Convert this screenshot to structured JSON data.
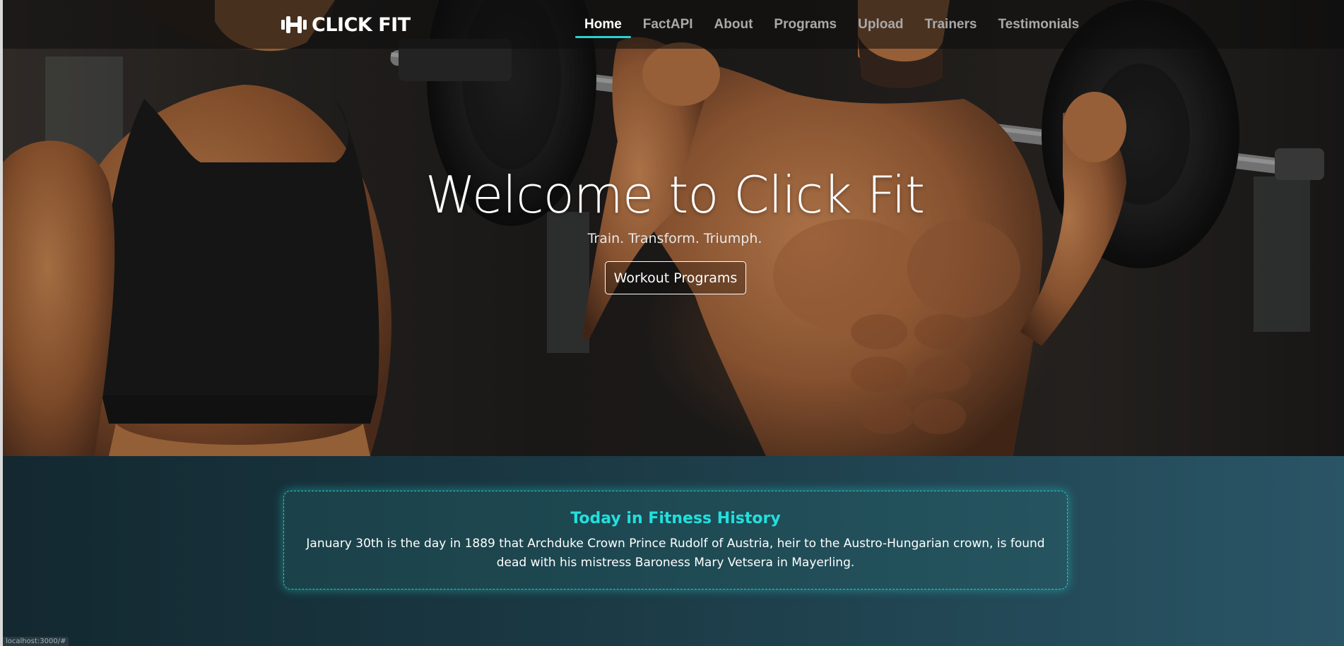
{
  "brand": {
    "name": "CLICK FIT",
    "icon": "dumbbell-icon"
  },
  "nav": {
    "items": [
      {
        "label": "Home",
        "active": true
      },
      {
        "label": "FactAPI",
        "active": false
      },
      {
        "label": "About",
        "active": false
      },
      {
        "label": "Programs",
        "active": false
      },
      {
        "label": "Upload",
        "active": false
      },
      {
        "label": "Trainers",
        "active": false
      },
      {
        "label": "Testimonials",
        "active": false
      }
    ]
  },
  "hero": {
    "title": "Welcome to Click Fit",
    "subtitle": "Train. Transform. Triumph.",
    "button_label": "Workout Programs"
  },
  "history": {
    "title": "Today in Fitness History",
    "text": "January 30th is the day in 1889 that Archduke Crown Prince Rudolf of Austria, heir to the Austro-Hungarian crown, is found dead with his mistress Baroness Mary Vetsera in Mayerling."
  },
  "status_bar": {
    "url": "localhost:3000/#"
  },
  "colors": {
    "accent": "#29d3cf",
    "history_title": "#22e0dd",
    "nav_inactive": "#a9a9a9",
    "nav_active": "#ffffff"
  }
}
